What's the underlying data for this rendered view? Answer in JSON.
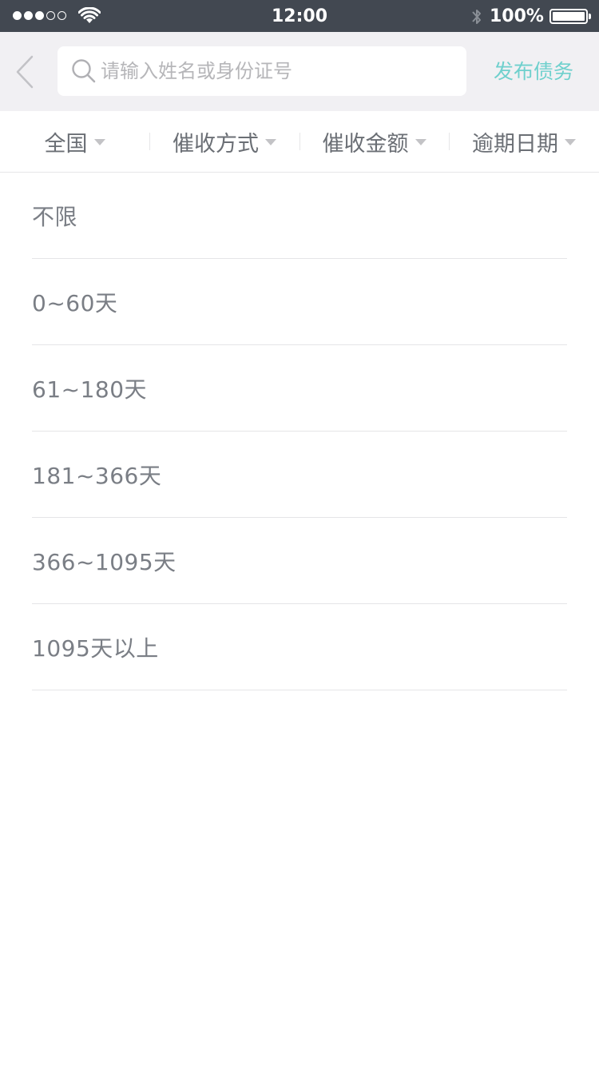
{
  "status_bar": {
    "time": "12:00",
    "battery_percent": "100%",
    "battery_level": 1.0,
    "signal_bars_filled": 3,
    "signal_bars_total": 5
  },
  "nav": {
    "back_icon": "chevron-left-icon",
    "search_placeholder": "请输入姓名或身份证号",
    "search_value": "",
    "publish_label": "发布债务"
  },
  "filters": [
    {
      "label": "全国"
    },
    {
      "label": "催收方式"
    },
    {
      "label": "催收金额"
    },
    {
      "label": "逾期日期"
    }
  ],
  "options": [
    {
      "label": "不限"
    },
    {
      "label": "0~60天"
    },
    {
      "label": "61~180天"
    },
    {
      "label": "181~366天"
    },
    {
      "label": "366~1095天"
    },
    {
      "label": "1095天以上"
    }
  ],
  "colors": {
    "status_bar_bg": "#424851",
    "nav_bg": "#f1f0f3",
    "accent": "#6fd0cd",
    "text": "#7a7e85",
    "divider": "#e5e5e7"
  }
}
